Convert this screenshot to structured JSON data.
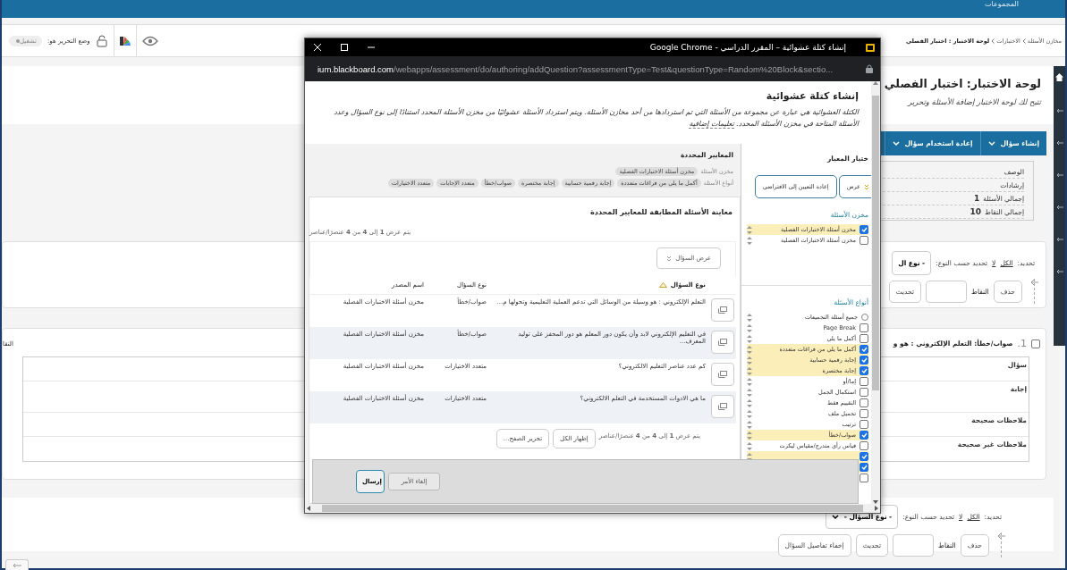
{
  "page": {
    "top_bar": {
      "label": "المجموعات"
    },
    "toolbar": {
      "edit_mode_label": "وضع التحرير هو:",
      "edit_mode_toggle": {
        "label": "تشغيل",
        "on": true
      }
    },
    "breadcrumb": [
      "مخازن الأسئلة",
      "الاختبارات",
      "لوحة الاختبار : اختبار الفصلي"
    ],
    "title": "لوحة الاختبار: اختبار الفصلي",
    "subtitle": "تتيح لك لوحة الاختبار إضافة الأسئلة وتحرير",
    "action_bar": [
      "إنشاء سؤال",
      "إعادة استخدام سؤال"
    ],
    "info": [
      {
        "label": "الوصف"
      },
      {
        "label": "إرشادات"
      },
      {
        "label": "إجمالي الأسئلة",
        "value": "1"
      },
      {
        "label": "إجمالي النقاط",
        "value": "10"
      }
    ],
    "top_controls": {
      "select_label": "تحديد:",
      "select_all": "الكل",
      "select_none": "لا",
      "by_type_label": "تحديد حسب النوع:",
      "type_select": "- نوع ال",
      "delete": "حذف",
      "points_label": "النقاط",
      "update": "تحديث"
    },
    "question": {
      "number": "1.",
      "heading": "صواب/خطأ: التعلم الإلكتروني : هو و",
      "checked": false,
      "points_label": "النقا",
      "rows": [
        "سؤال",
        "إجابة",
        "ملاحظات صحيحة",
        "ملاحظات غير صحيحة"
      ]
    },
    "bottom_controls": {
      "select_label": "تحديد:",
      "select_all": "الكل",
      "select_none": "لا",
      "by_type_label": "تحديد حسب النوع:",
      "type_select": "- نوع السؤال -",
      "delete": "حذف",
      "points_label": "النقاط",
      "update": "تحديث",
      "hide_details": "إخفاء تفاصيل السؤال"
    }
  },
  "popup": {
    "window_title": "إنشاء كتلة عشوائية – المقرر الدراسي - Google Chrome",
    "url_domain": "ium.blackboard.com",
    "url_path": "/webapps/assessment/do/authoring/addQuestion?assessmentType=Test&questionType=Random%20Block&sectio...",
    "heading": "إنشاء كتلة عشوائية",
    "description": "الكتلة العشوائية هي عبارة عن مجموعة من الأسئلة التي تم استردادها من أحد مخازن الأسئلة. ويتم استرداد الأسئلة عشوائيًا من مخزن الأسئلة المحدد استنادًا إلى نوع السؤال وعدد الأسئلة المتاحة في مخزن الأسئلة المحدد.",
    "description_link": "تعليمات إضافية",
    "filter": {
      "title": "ختيار المعيار",
      "view_button": "عرض",
      "reset_button": "إعادة التعيين إلى الافتراضي",
      "pools_heading": "مخزن الأسئلة",
      "pools": [
        {
          "label": "مخزن أسئلة الاختبارات الفصلية",
          "checked": true
        },
        {
          "label": "مخزن أسئلة الاختبارات الفصلية",
          "checked": false
        }
      ],
      "types_heading": "أنواع الأسئلة",
      "types": [
        {
          "kind": "radio",
          "label": "جميع أسئلة التجميعات",
          "checked": false
        },
        {
          "kind": "checkbox",
          "label": "Page Break",
          "checked": false
        },
        {
          "kind": "checkbox",
          "label": "أكمل ما يلي",
          "checked": false
        },
        {
          "kind": "checkbox",
          "label": "أكمل ما يلي من فراغات متعددة",
          "checked": true
        },
        {
          "kind": "checkbox",
          "label": "إجابة رقمية حسابية",
          "checked": true
        },
        {
          "kind": "checkbox",
          "label": "إجابة مختصرة",
          "checked": true
        },
        {
          "kind": "checkbox",
          "label": "إما/أو",
          "checked": false
        },
        {
          "kind": "checkbox",
          "label": "استكمال الجمل",
          "checked": false
        },
        {
          "kind": "checkbox",
          "label": "التقييم فقط",
          "checked": false
        },
        {
          "kind": "checkbox",
          "label": "تحميل ملف",
          "checked": false
        },
        {
          "kind": "checkbox",
          "label": "ترتيب",
          "checked": false
        },
        {
          "kind": "checkbox",
          "label": "صواب/خطأ",
          "checked": true
        },
        {
          "kind": "checkbox",
          "label": "قياس رأي متدرج/مقياس ليكرت",
          "checked": false
        },
        {
          "kind": "checkbox",
          "checked": true
        },
        {
          "kind": "checkbox",
          "checked": true
        },
        {
          "kind": "checkbox",
          "checked": false
        }
      ]
    },
    "criteria": {
      "title": "المعايير المحددة",
      "pool_label": "مخزن الأسئلة",
      "pool_chips": [
        "مخزن أسئلة الاختبارات الفصلية"
      ],
      "types_label": "أنواع الأسئلة",
      "type_chips": [
        "أكمل ما يلي من فراغات متعددة",
        "إجابة رقمية حسابية",
        "إجابة مختصرة",
        "صواب/خطأ",
        "متعدد الإجابات",
        "متعدد الاختيارات"
      ]
    },
    "preview": {
      "title": "معاينة الأسئلة المطابقة للمعايير المحددة",
      "count_top": "يتم عرض **1** إلى **4** من **4** عنصرًا/عناصر",
      "view_question": "عرض السؤال",
      "columns": [
        "نوع السؤال",
        "نوع السؤال",
        "اسم المصدر"
      ],
      "rows": [
        {
          "text": "التعلم الإلكتروني : هو وسيلة من الوسائل التي تدعم العملية التعليمية وتحولها م...",
          "type": "صواب/خطأ",
          "source": "مخزن أسئلة الاختبارات الفصلية"
        },
        {
          "text": "في التعليم الإلكتروني لابد وأن يكون دور المعلم هو دور المحفز على توليد المعرف...",
          "type": "صواب/خطأ",
          "source": "مخزن أسئلة الاختبارات الفصلية"
        },
        {
          "text": "كم عدد عناصر التعليم الالكتروني؟",
          "type": "متعدد الاختيارات",
          "source": "مخزن أسئلة الاختبارات الفصلية"
        },
        {
          "text": "ما هي الادوات المستخدمة في التعلم الالكتروني؟",
          "type": "متعدد الاختيارات",
          "source": "مخزن أسئلة الاختبارات الفصلية"
        }
      ],
      "count_bottom": "يتم عرض **1** إلى **4** من **4** عنصرًا/عناصر",
      "show_all": "إظهار الكل",
      "paging": "تحرير الصفح..."
    },
    "footer": {
      "submit": "إرسال",
      "cancel": "إلغاء الأمر"
    }
  }
}
